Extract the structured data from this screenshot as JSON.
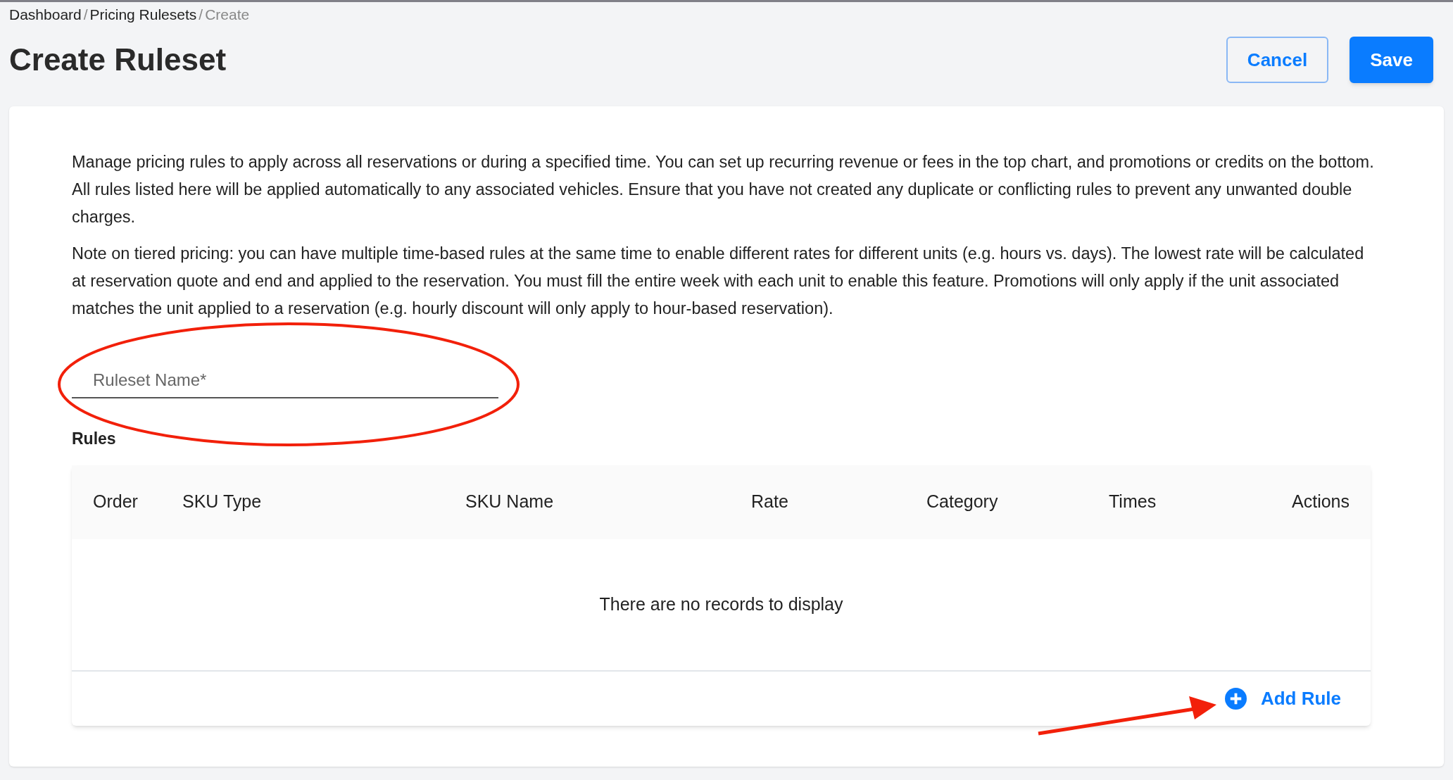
{
  "breadcrumb": [
    {
      "label": "Dashboard",
      "current": false
    },
    {
      "label": "Pricing Rulesets",
      "current": false
    },
    {
      "label": "Create",
      "current": true
    }
  ],
  "breadcrumb_separator": "/",
  "title": "Create Ruleset",
  "buttons": [
    {
      "label": "Cancel",
      "kind": "outline"
    },
    {
      "label": "Save",
      "kind": "primary"
    }
  ],
  "paragraphs": [
    "Manage pricing rules to apply across all reservations or during a specified time. You can set up recurring revenue or fees in the top chart, and promotions or credits on the bottom. All rules listed here will be applied automatically to any associated vehicles. Ensure that you have not created any duplicate or conflicting rules to prevent any unwanted double charges.",
    "Note on tiered pricing: you can have multiple time-based rules at the same time to enable different rates for different units (e.g. hours vs. days). The lowest rate will be calculated at reservation quote and end and applied to the reservation. You must fill the entire week with each unit to enable this feature. Promotions will only apply if the unit associated matches the unit applied to a reservation (e.g. hourly discount will only apply to hour-based reservation)."
  ],
  "ruleset_name": {
    "placeholder": "Ruleset Name*"
  },
  "rules": {
    "label": "Rules",
    "columns": [
      "Order",
      "SKU Type",
      "SKU Name",
      "Rate",
      "Category",
      "Times",
      "Actions"
    ],
    "empty_message": "There are no records to display",
    "add_button": "Add Rule"
  }
}
